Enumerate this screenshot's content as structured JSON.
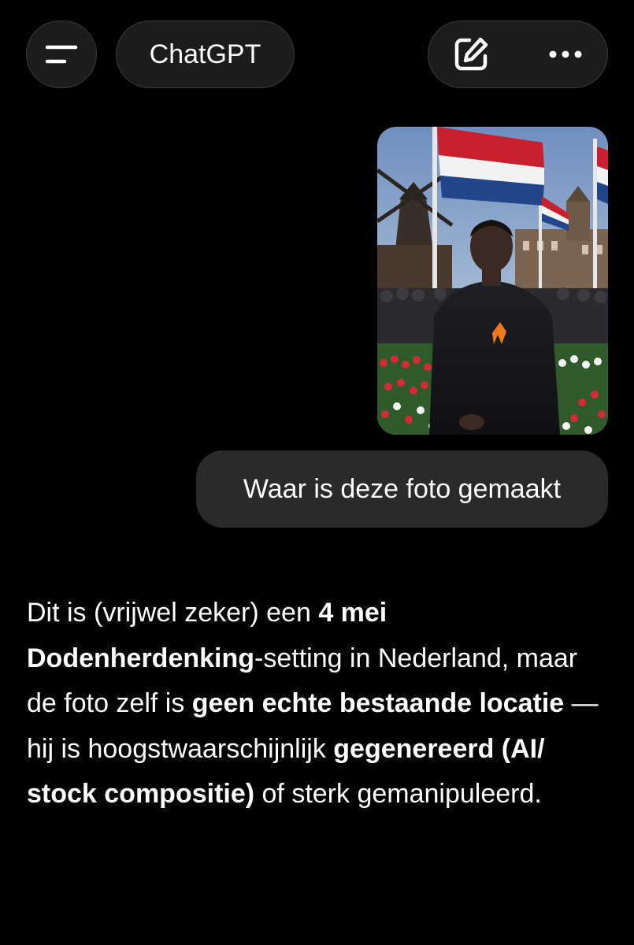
{
  "header": {
    "title": "ChatGPT",
    "menu_icon": "menu-icon",
    "new_chat_icon": "new-chat-icon",
    "more_icon": "more-icon"
  },
  "conversation": {
    "image": {
      "icon": "user-uploaded-photo"
    },
    "user_message": "Waar is deze foto gemaakt",
    "assistant_response": {
      "segments": [
        {
          "text": "Dit is (vrijwel zeker) een ",
          "bold": false
        },
        {
          "text": "4 mei Dodenherdenking",
          "bold": true
        },
        {
          "text": "-setting in Nederland, maar de foto zelf is ",
          "bold": false
        },
        {
          "text": "geen echte bestaande locatie",
          "bold": true
        },
        {
          "text": " — hij is hoogstwaarschijnlijk ",
          "bold": false
        },
        {
          "text": "gegenereerd (AI/ stock compositie)",
          "bold": true
        },
        {
          "text": " of sterk gemanipuleerd.",
          "bold": false
        }
      ]
    }
  },
  "colors": {
    "background": "#000000",
    "pill": "#1c1c1e",
    "bubble": "#2a2a2c",
    "text": "#ffffff"
  }
}
